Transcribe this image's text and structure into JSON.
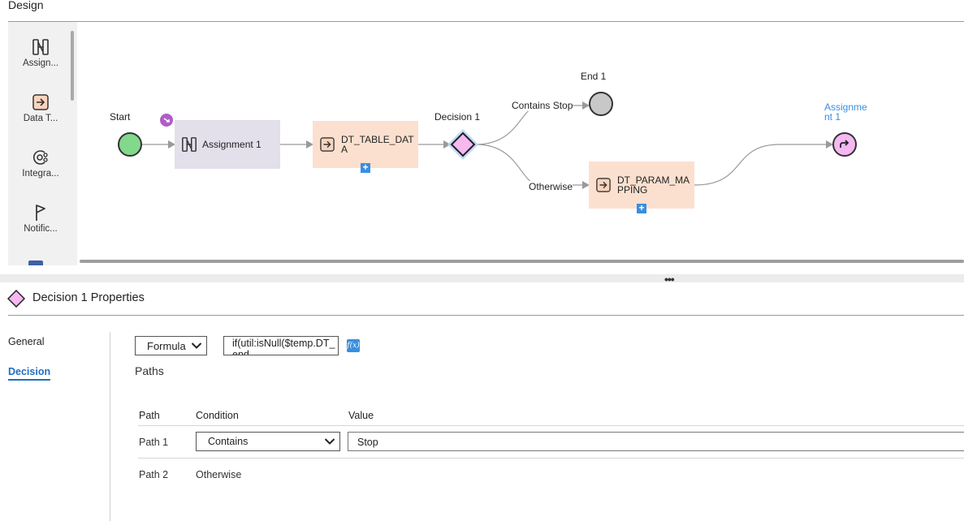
{
  "design": {
    "title": "Design"
  },
  "palette": {
    "items": [
      {
        "label": "Assign...",
        "icon": "assignment-icon"
      },
      {
        "label": "Data T...",
        "icon": "data-task-icon"
      },
      {
        "label": "Integra...",
        "icon": "integration-icon"
      },
      {
        "label": "Notific...",
        "icon": "notification-flag-icon"
      }
    ]
  },
  "canvas": {
    "start_label": "Start",
    "assignment_label": "Assignment 1",
    "dt_table_label_1": "DT_TABLE_DAT",
    "dt_table_label_2": "A",
    "decision_label": "Decision 1",
    "end_label": "End 1",
    "contains_stop_label": "Contains Stop",
    "otherwise_label": "Otherwise",
    "dt_param_label_1": "DT_PARAM_MA",
    "dt_param_label_2": "PPING",
    "assignment_link_1": "Assignme",
    "assignment_link_2": "nt 1",
    "add_symbol": "+"
  },
  "divider": {
    "dots": "•••"
  },
  "properties": {
    "title": "Decision 1 Properties",
    "tabs": [
      {
        "label": "General",
        "active": false
      },
      {
        "label": "Decision",
        "active": true
      }
    ],
    "mode_select": "Formula",
    "formula_text": "if(util:isNull($temp.DT_",
    "formula_text_2": "end",
    "fx_label": "f(x)",
    "paths_title": "Paths",
    "table": {
      "headers": [
        "Path",
        "Condition",
        "Value"
      ],
      "rows": [
        {
          "path": "Path 1",
          "condition": "Contains",
          "value": "Stop"
        },
        {
          "path": "Path 2",
          "condition": "Otherwise",
          "value": ""
        }
      ]
    }
  },
  "colors": {
    "start": "#82d88c",
    "end": "#c8c8c8",
    "decision": "#f5b8f1",
    "assignment_box": "#e3dfeb",
    "task_box": "#fce0cf",
    "accent": "#3a8ee0"
  }
}
